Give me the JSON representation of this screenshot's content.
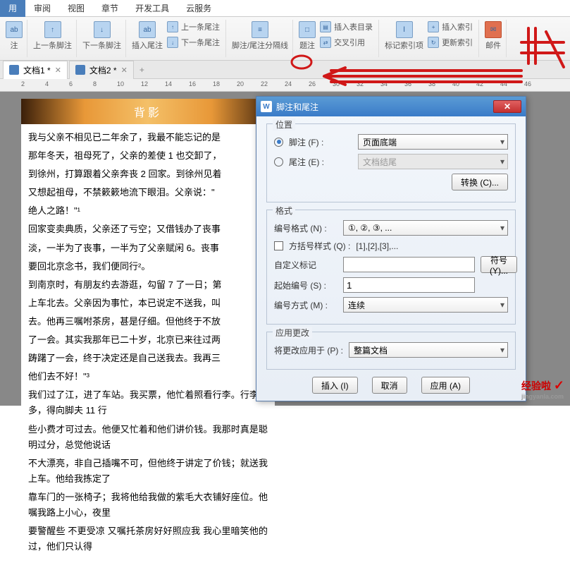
{
  "ribbon": {
    "tabs": [
      "用",
      "审阅",
      "视图",
      "章节",
      "开发工具",
      "云服务"
    ]
  },
  "toolbar": {
    "groups": [
      {
        "big": {
          "label": "注"
        },
        "small": []
      },
      {
        "big": {
          "label": "上一条脚注"
        },
        "small": []
      },
      {
        "big": {
          "label": "下一条脚注"
        },
        "small": []
      },
      {
        "big": {
          "label": "插入尾注"
        },
        "small": [
          {
            "label": "上一条尾注"
          },
          {
            "label": "下一条尾注"
          }
        ]
      },
      {
        "big": {
          "label": "脚注/尾注分隔线"
        },
        "small": []
      },
      {
        "big": {
          "label": "题注"
        },
        "small": [
          {
            "label": "插入表目录"
          },
          {
            "label": "交叉引用"
          }
        ]
      },
      {
        "big": {
          "label": "标记索引项"
        },
        "small": [
          {
            "label": "插入索引"
          },
          {
            "label": "更新索引"
          }
        ]
      },
      {
        "big": {
          "label": "邮件"
        },
        "small": []
      }
    ]
  },
  "doc_tabs": {
    "tab1": "文档1 *",
    "tab2": "文档2 *"
  },
  "ruler_marks": [
    "2",
    "4",
    "6",
    "8",
    "10",
    "12",
    "14",
    "16",
    "18",
    "20",
    "22",
    "24",
    "26",
    "30",
    "32",
    "34",
    "36",
    "38",
    "40",
    "42",
    "44",
    "46"
  ],
  "banner": "背影",
  "paragraphs": [
    "我与父亲不相见已二年余了，我最不能忘记的是",
    "那年冬天，祖母死了，父亲的差使 1 也交卸了，",
    "到徐州，打算跟着父亲奔丧 2 回家。到徐州见着",
    "又想起祖母，不禁簌簌地流下眼泪。父亲说：\"",
    "绝人之路！\"¹",
    "回家变卖典质，父亲还了亏空；又借钱办了丧事",
    "淡，一半为了丧事，一半为了父亲赋闲 6。丧事",
    "要回北京念书，我们便同行²。",
    "到南京时，有朋友约去游逛，勾留 7 了一日；第",
    "上车北去。父亲因为事忙，本已说定不送我，叫",
    "去。他再三嘱咐茶房，甚是仔细。但他终于不放",
    "了一会。其实我那年已二十岁，北京已来往过两",
    "踌躇了一会，终于决定还是自己送我去。我再三",
    "他们去不好！\"³",
    "我们过了江，进了车站。我买票，他忙着照看行李。行李太多，得向脚夫 11 行",
    "些小费才可过去。他便又忙着和他们讲价钱。我那时真是聪明过分，总觉他说话",
    "不大漂亮，非自己插嘴不可，但他终于讲定了价钱；就送我上车。他给我拣定了",
    "靠车门的一张椅子；我将他给我做的紫毛大衣铺好座位。他嘱我路上小心，夜里",
    "要警醒些  不更受凉  又嘱托茶房好好照应我  我心里暗笑他的过，他们只认得"
  ],
  "dialog": {
    "title": "脚注和尾注",
    "sections": {
      "position": {
        "legend": "位置",
        "footnote_label": "脚注 (F) :",
        "footnote_value": "页面底端",
        "endnote_label": "尾注 (E) :",
        "endnote_value": "文档结尾",
        "convert_btn": "转换 (C)..."
      },
      "format": {
        "legend": "格式",
        "numfmt_label": "编号格式 (N) :",
        "numfmt_value": "①, ②, ③, ...",
        "bracket_label": "方括号样式 (Q) :",
        "bracket_value": "[1],[2],[3],...",
        "custom_label": "自定义标记",
        "symbol_btn": "符号 (Y)...",
        "start_label": "起始编号 (S) :",
        "start_value": "1",
        "method_label": "编号方式 (M) :",
        "method_value": "连续"
      },
      "apply": {
        "legend": "应用更改",
        "applyto_label": "将更改应用于 (P) :",
        "applyto_value": "整篇文档"
      }
    },
    "buttons": {
      "insert": "插入 (I)",
      "cancel": "取消",
      "apply": "应用 (A)"
    }
  },
  "watermark": {
    "main": "经验啦",
    "sub": "jingyanla.com"
  }
}
